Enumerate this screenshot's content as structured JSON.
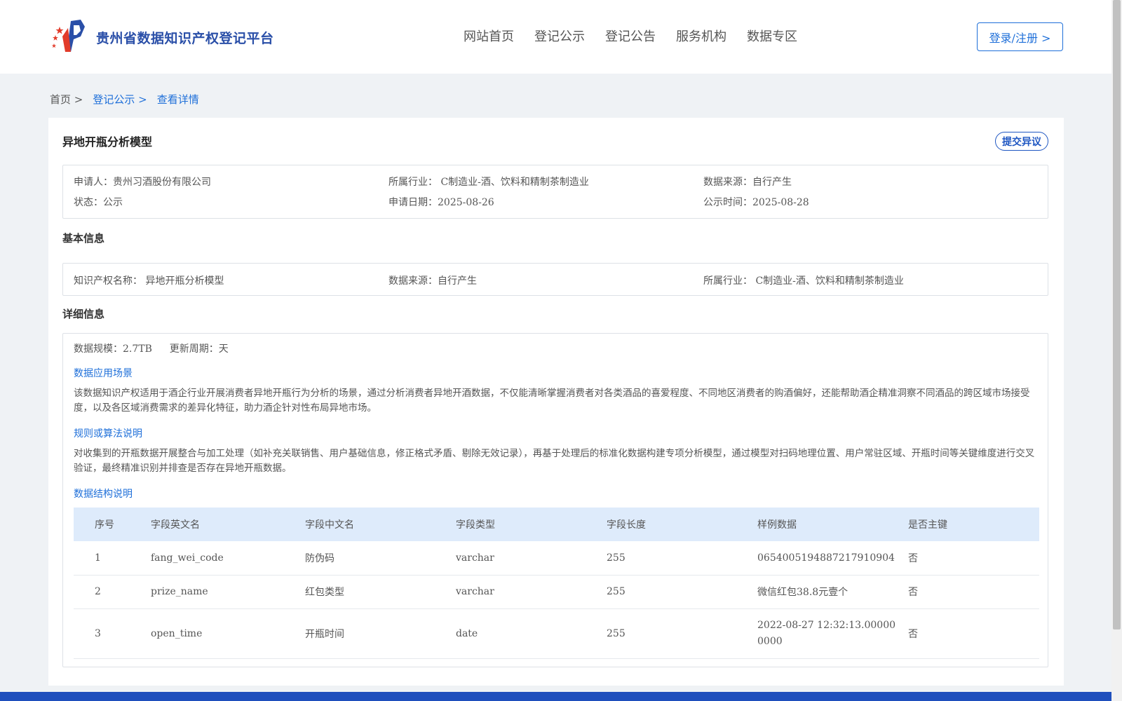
{
  "header": {
    "site_title": "贵州省数据知识产权登记平台",
    "nav": [
      "网站首页",
      "登记公示",
      "登记公告",
      "服务机构",
      "数据专区"
    ],
    "login_label": "登录/注册 >"
  },
  "breadcrumb": {
    "home": "首页 >",
    "list": "登记公示 >",
    "current": "查看详情"
  },
  "record": {
    "title": "异地开瓶分析模型",
    "objection_label": "提交异议",
    "summary": {
      "applicant_label": "申请人：",
      "applicant": "贵州习酒股份有限公司",
      "industry_label": "所属行业：",
      "industry": "C制造业-酒、饮料和精制茶制造业",
      "source_label": "数据来源：",
      "source": "自行产生",
      "status_label": "状态：",
      "status": "公示",
      "apply_date_label": "申请日期：",
      "apply_date": "2025-08-26",
      "publish_date_label": "公示时间：",
      "publish_date": "2025-08-28"
    }
  },
  "basic": {
    "section_title": "基本信息",
    "ip_name_label": "知识产权名称：",
    "ip_name": "异地开瓶分析模型",
    "source_label": "数据来源：",
    "source": "自行产生",
    "industry_label": "所属行业：",
    "industry": "C制造业-酒、饮料和精制茶制造业"
  },
  "detail": {
    "section_title": "详细信息",
    "scale_label": "数据规模：",
    "scale": "2.7TB",
    "cycle_label": "更新周期：",
    "cycle": "天",
    "scenario_title": "数据应用场景",
    "scenario_text": "该数据知识产权适用于酒企行业开展消费者异地开瓶行为分析的场景，通过分析消费者异地开酒数据，不仅能清晰掌握消费者对各类酒品的喜爱程度、不同地区消费者的购酒偏好，还能帮助酒企精准洞察不同酒品的跨区域市场接受度，以及各区域消费需求的差异化特征，助力酒企针对性布局异地市场。",
    "algorithm_title": "规则或算法说明",
    "algorithm_text": "对收集到的开瓶数据开展整合与加工处理（如补充关联销售、用户基础信息，修正格式矛盾、剔除无效记录），再基于处理后的标准化数据构建专项分析模型，通过模型对扫码地理位置、用户常驻区域、开瓶时间等关键维度进行交叉验证，最终精准识别并排查是否存在异地开瓶数据。",
    "structure_title": "数据结构说明",
    "table": {
      "headers": [
        "序号",
        "字段英文名",
        "字段中文名",
        "字段类型",
        "字段长度",
        "样例数据",
        "是否主键"
      ],
      "rows": [
        [
          "1",
          "fang_wei_code",
          "防伪码",
          "varchar",
          "255",
          "0654005194887217910904",
          "否"
        ],
        [
          "2",
          "prize_name",
          "红包类型",
          "varchar",
          "255",
          "微信红包38.8元壹个",
          "否"
        ],
        [
          "3",
          "open_time",
          "开瓶时间",
          "date",
          "255",
          "2022-08-27 12:32:13.000000000",
          "否"
        ]
      ]
    }
  },
  "colors": {
    "accent": "#1e6fd9",
    "brand": "#2a4fa8",
    "table_header_bg": "#deebfb",
    "footer": "#1f4fbd"
  }
}
